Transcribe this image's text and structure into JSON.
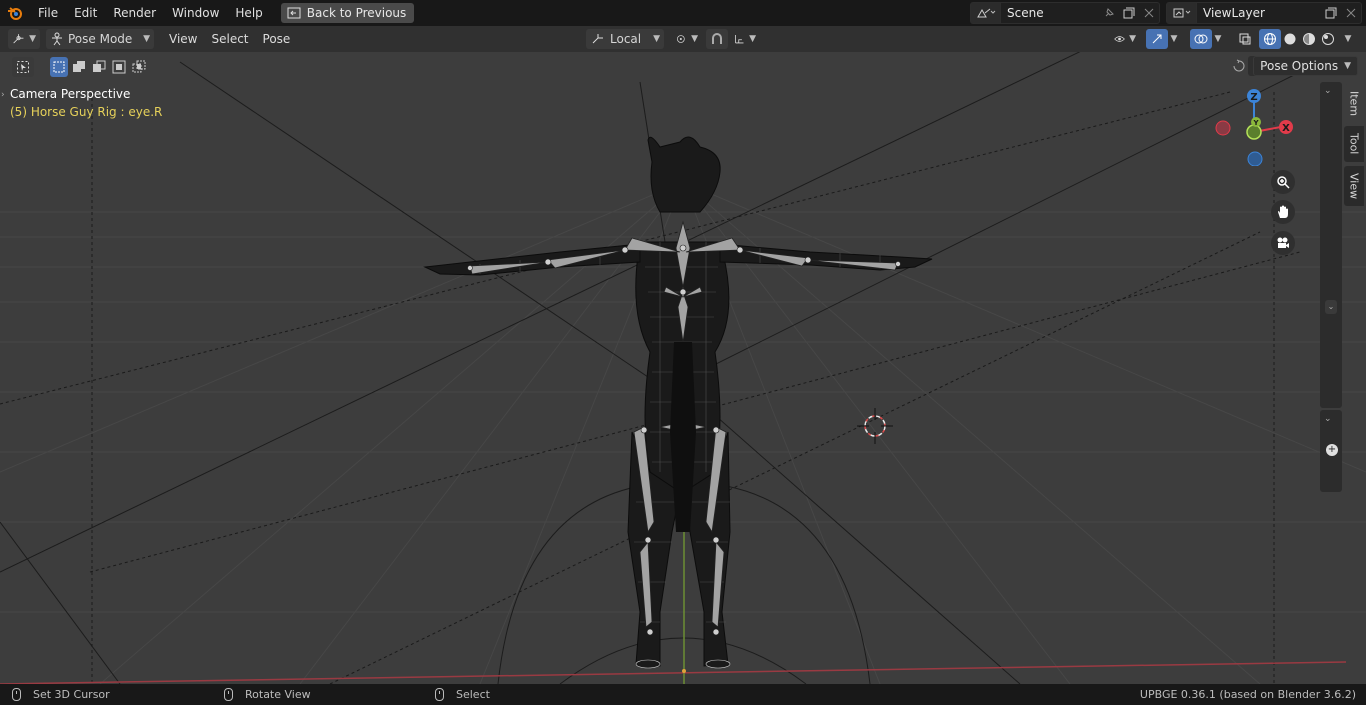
{
  "topbar": {
    "menus": [
      "File",
      "Edit",
      "Render",
      "Window",
      "Help"
    ],
    "back_label": "Back to Previous",
    "scene_name": "Scene",
    "view_layer": "ViewLayer"
  },
  "header": {
    "mode": "Pose Mode",
    "menus": [
      "View",
      "Select",
      "Pose"
    ],
    "transform_orientation": "Local"
  },
  "viewport": {
    "camera_title": "Camera Perspective",
    "object_info": "(5) Horse Guy Rig : eye.R",
    "pose_options": "Pose Options",
    "gizmo": {
      "x": "X",
      "y": "Y",
      "z": "Z"
    },
    "close_label": "X"
  },
  "sidebar_tabs": [
    "Item",
    "Tool",
    "View"
  ],
  "statusbar": {
    "items": [
      "Set 3D Cursor",
      "Rotate View",
      "Select"
    ],
    "version": "UPBGE 0.36.1 (based on Blender 3.6.2)"
  },
  "colors": {
    "accent": "#4772b3",
    "axis_x": "#e23b4a",
    "axis_y": "#8ab73b",
    "axis_z": "#3c84d8",
    "active_object_text": "#e6d15a"
  }
}
